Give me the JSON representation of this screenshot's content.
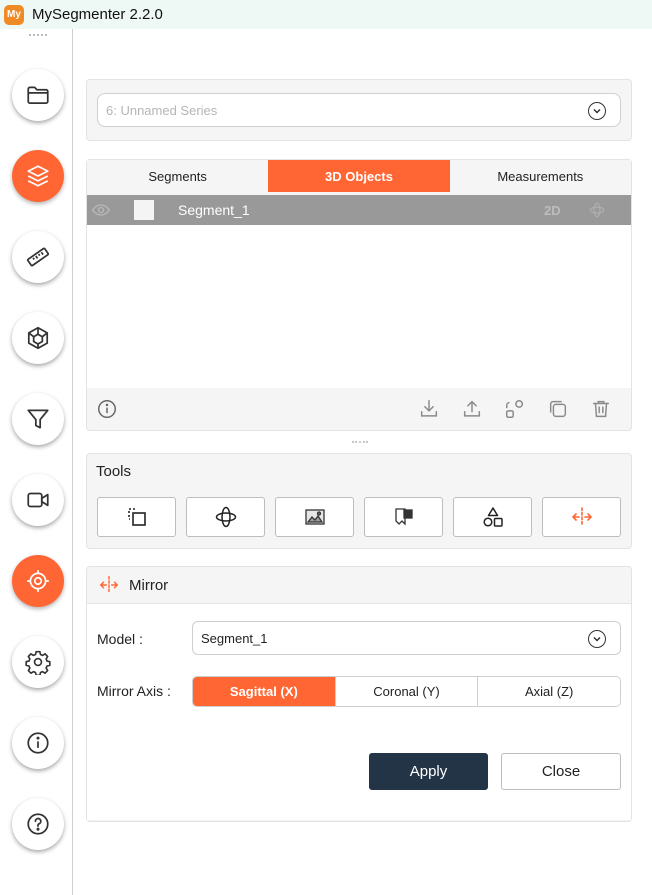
{
  "app": {
    "logo": "My",
    "title": "MySegmenter 2.2.0"
  },
  "sidebar": {
    "items": [
      {
        "name": "folder-icon",
        "active": false
      },
      {
        "name": "layers-icon",
        "active": true
      },
      {
        "name": "ruler-icon",
        "active": false
      },
      {
        "name": "cube-icon",
        "active": false
      },
      {
        "name": "filter-icon",
        "active": false
      },
      {
        "name": "video-camera-icon",
        "active": false
      },
      {
        "name": "target-icon",
        "active": true
      },
      {
        "name": "gear-icon",
        "active": false
      },
      {
        "name": "info-icon",
        "active": false
      },
      {
        "name": "help-icon",
        "active": false
      }
    ],
    "accent": "#ff6633"
  },
  "series": {
    "value": "6: Unnamed Series"
  },
  "tabs": [
    {
      "label": "Segments"
    },
    {
      "label": "3D Objects"
    },
    {
      "label": "Measurements"
    }
  ],
  "active_tab": "3D Objects",
  "segments": [
    {
      "name": "Segment_1",
      "mode": "2D"
    }
  ],
  "object_actions": [
    "download-icon",
    "upload-icon",
    "shapes-icon",
    "copy-icon",
    "trash-icon"
  ],
  "tools": {
    "title": "Tools",
    "items": [
      "crop-select-icon",
      "orbit-icon",
      "image-icon",
      "paint-icon",
      "shapes-icon",
      "mirror-icon"
    ],
    "active_item": "mirror-icon"
  },
  "mirror": {
    "title": "Mirror",
    "model_label": "Model :",
    "model_value": "Segment_1",
    "axis_label": "Mirror Axis :",
    "axes": [
      {
        "label": "Sagittal (X)"
      },
      {
        "label": "Coronal (Y)"
      },
      {
        "label": "Axial (Z)"
      }
    ],
    "active_axis": "Sagittal (X)",
    "apply_label": "Apply",
    "close_label": "Close"
  },
  "colors": {
    "accent": "#ff6633",
    "dark_button": "#243447",
    "titlebar": "#eef8f4"
  }
}
